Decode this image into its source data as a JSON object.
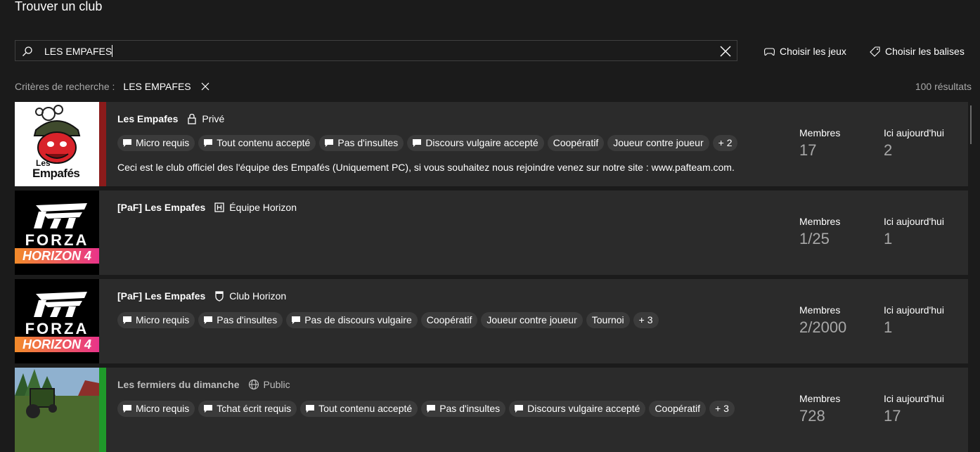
{
  "page": {
    "title": "Trouver un club"
  },
  "search": {
    "value": "LES EMPAFES"
  },
  "actions": {
    "choose_games": "Choisir les jeux",
    "choose_tags": "Choisir les balises"
  },
  "criteria": {
    "label": "Critères de recherche :",
    "term": "LES EMPAFES",
    "result_count": "100 résultats"
  },
  "stat_labels": {
    "members": "Membres",
    "today": "Ici aujourd'hui"
  },
  "clubs": [
    {
      "name": "Les Empafes",
      "type_icon": "lock-icon",
      "type": "Privé",
      "accent": "#8b1b1b",
      "logo_text": "Les",
      "logo_word": "Empafés",
      "tags": [
        "Micro requis",
        "Tout contenu accepté",
        "Pas d'insultes",
        "Discours vulgaire accepté",
        "Coopératif",
        "Joueur contre joueur",
        "+ 2"
      ],
      "description": "Ceci est le club officiel des l'équipe des Empafés (Uniquement PC), si vous souhaitez nous rejoindre venez sur notre site : www.pafteam.com.",
      "members": "17",
      "today": "2"
    },
    {
      "name": "[PaF] Les Empafes",
      "type_icon": "horizon-badge-icon",
      "type": "Équipe Horizon",
      "logo_line1": "FORZA",
      "logo_line2": "HORIZON 4",
      "tags": [],
      "members": "1/25",
      "today": "1"
    },
    {
      "name": "[PaF] Les Empafes",
      "type_icon": "shield-icon",
      "type": "Club Horizon",
      "logo_line1": "FORZA",
      "logo_line2": "HORIZON 4",
      "tags": [
        "Micro requis",
        "Pas d'insultes",
        "Pas de discours vulgaire",
        "Coopératif",
        "Joueur contre joueur",
        "Tournoi",
        "+ 3"
      ],
      "members": "2/2000",
      "today": "1"
    },
    {
      "name": "Les fermiers du dimanche",
      "type_icon": "globe-icon",
      "type": "Public",
      "accent": "#1f9a2a",
      "tags": [
        "Micro requis",
        "Tchat écrit requis",
        "Tout contenu accepté",
        "Pas d'insultes",
        "Discours vulgaire accepté",
        "Coopératif",
        "+ 3"
      ],
      "members": "728",
      "today": "17"
    }
  ]
}
